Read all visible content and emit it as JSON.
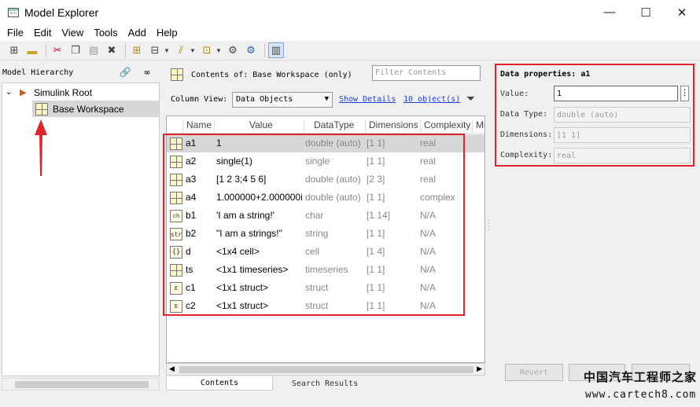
{
  "window": {
    "title": "Model Explorer",
    "minimize": "—",
    "maximize": "☐",
    "close": "✕"
  },
  "menu": [
    "File",
    "Edit",
    "View",
    "Tools",
    "Add",
    "Help"
  ],
  "hierarchy": {
    "header": "Model Hierarchy",
    "root_label": "Simulink Root",
    "workspace_label": "Base Workspace"
  },
  "contents": {
    "label": "Contents of: Base Workspace (only)",
    "filter_placeholder": "Filter Contents",
    "column_view_label": "Column View:",
    "column_view_value": "Data Objects",
    "show_details": "Show Details",
    "object_count": "10 object(s)"
  },
  "table": {
    "columns": [
      "Name",
      "Value",
      "DataType",
      "Dimensions",
      "Complexity",
      "Mi"
    ],
    "rows": [
      {
        "icon": "matrix",
        "name": "a1",
        "value": "1",
        "type": "double (auto)",
        "dims": "[1 1]",
        "complexity": "real"
      },
      {
        "icon": "matrix",
        "name": "a2",
        "value": "single(1)",
        "type": "single",
        "dims": "[1 1]",
        "complexity": "real"
      },
      {
        "icon": "matrix",
        "name": "a3",
        "value": "[1 2 3;4 5 6]",
        "type": "double (auto)",
        "dims": "[2 3]",
        "complexity": "real"
      },
      {
        "icon": "matrix",
        "name": "a4",
        "value": "1.000000+2.000000i",
        "type": "double (auto)",
        "dims": "[1 1]",
        "complexity": "complex"
      },
      {
        "icon": "ch",
        "name": "b1",
        "value": "'I am a string!'",
        "type": "char",
        "dims": "[1 14]",
        "complexity": "N/A"
      },
      {
        "icon": "str",
        "name": "b2",
        "value": "\"I am a strings!\"",
        "type": "string",
        "dims": "[1 1]",
        "complexity": "N/A"
      },
      {
        "icon": "{}",
        "name": "d",
        "value": "<1x4 cell>",
        "type": "cell",
        "dims": "[1 4]",
        "complexity": "N/A"
      },
      {
        "icon": "matrix",
        "name": "ts",
        "value": "<1x1 timeseries>",
        "type": "timeseries",
        "dims": "[1 1]",
        "complexity": "N/A"
      },
      {
        "icon": "E",
        "name": "c1",
        "value": "<1x1 struct>",
        "type": "struct",
        "dims": "[1 1]",
        "complexity": "N/A"
      },
      {
        "icon": "E",
        "name": "c2",
        "value": "<1x1 struct>",
        "type": "struct",
        "dims": "[1 1]",
        "complexity": "N/A"
      }
    ]
  },
  "tabs": [
    "Contents",
    "Search Results"
  ],
  "properties": {
    "title": "Data properties: a1",
    "value_label": "Value:",
    "value": "1",
    "datatype_label": "Data Type:",
    "datatype": "double (auto)",
    "dimensions_label": "Dimensions:",
    "dimensions": "[1 1]",
    "complexity_label": "Complexity:",
    "complexity": "real"
  },
  "buttons": {
    "revert": "Revert"
  },
  "watermark": {
    "line1": "中国汽车工程师之家",
    "line2": "www.cartech8.com"
  },
  "colors": {
    "highlight": "#e0242e",
    "link": "#1a3fd6",
    "selection": "#d7d7d7"
  }
}
